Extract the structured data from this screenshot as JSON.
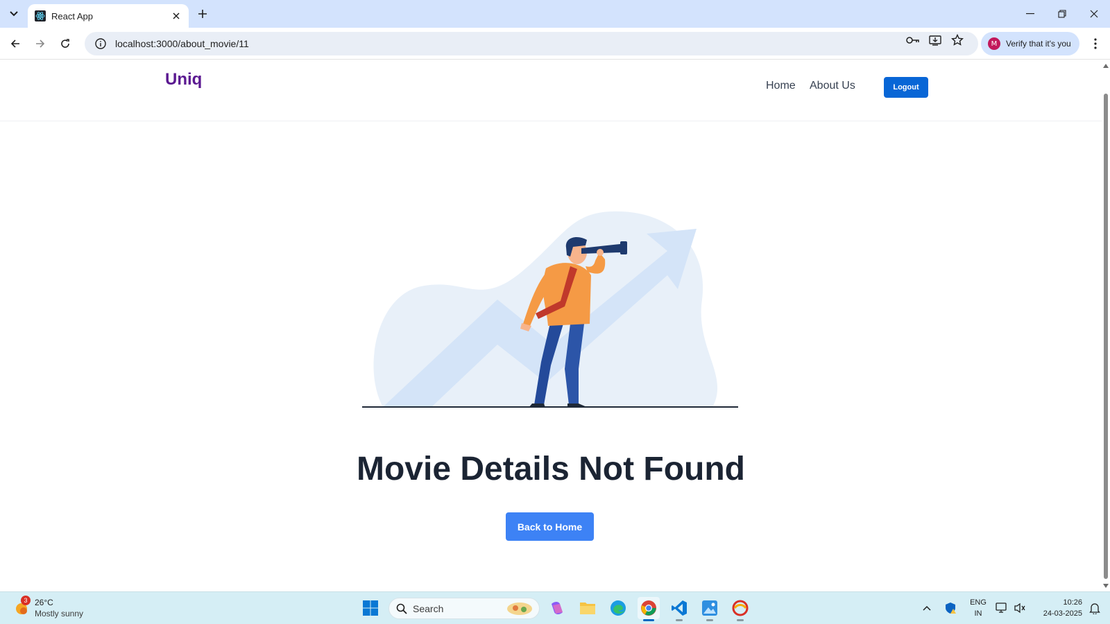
{
  "browser": {
    "tab_title": "React App",
    "url": "localhost:3000/about_movie/11",
    "profile_initial": "M",
    "profile_label": "Verify that it's you"
  },
  "site": {
    "logo": "Uniq",
    "nav": [
      {
        "label": "Home"
      },
      {
        "label": "About Us"
      }
    ],
    "logout_label": "Logout",
    "heading": "Movie Details Not Found",
    "back_label": "Back to Home"
  },
  "taskbar": {
    "weather_badge": "3",
    "weather_temp": "26°C",
    "weather_desc": "Mostly sunny",
    "search_label": "Search",
    "lang_line1": "ENG",
    "lang_line2": "IN",
    "time": "10:26",
    "date": "24-03-2025"
  },
  "colors": {
    "logo": "#5b1991",
    "logout_button": "#0866d6",
    "back_button": "#3d82f5",
    "heading": "#1b2433",
    "chrome_frame": "#d3e3fd",
    "taskbar": "#d5eef5"
  },
  "icons": [
    "tab-list-icon",
    "react-favicon-icon",
    "close-icon",
    "plus-icon",
    "minimize-icon",
    "restore-icon",
    "back-arrow-icon",
    "forward-arrow-icon",
    "reload-icon",
    "site-info-icon",
    "password-key-icon",
    "install-icon",
    "star-icon",
    "more-vert-icon",
    "weather-sun-icon",
    "windows-start-icon",
    "search-icon",
    "copilot-icon",
    "file-explorer-icon",
    "edge-icon",
    "chrome-icon",
    "vscode-icon",
    "photos-icon",
    "app-icon",
    "chevron-up-icon",
    "shield-icon",
    "network-icon",
    "volume-icon",
    "bell-icon"
  ]
}
